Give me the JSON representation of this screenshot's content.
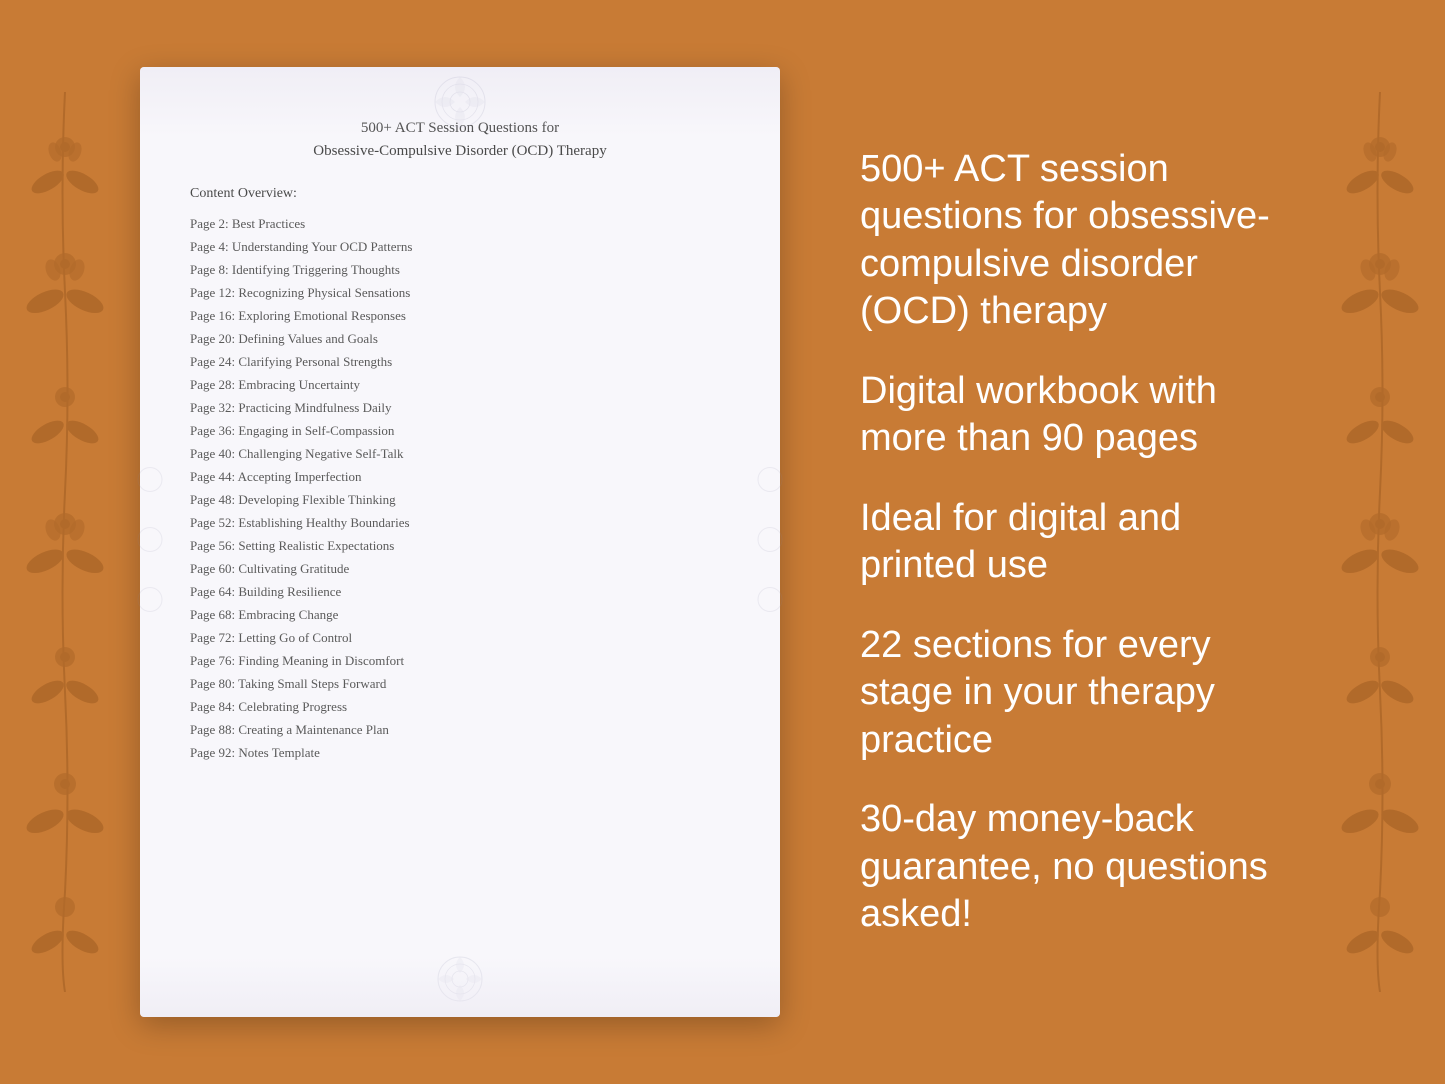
{
  "background": {
    "color": "#C87B35"
  },
  "document": {
    "title_line1": "500+ ACT Session Questions for",
    "title_line2": "Obsessive-Compulsive Disorder (OCD) Therapy",
    "content_overview_label": "Content Overview:",
    "toc_entries": [
      {
        "page": "Page  2:",
        "title": "Best Practices"
      },
      {
        "page": "Page  4:",
        "title": "Understanding Your OCD Patterns"
      },
      {
        "page": "Page  8:",
        "title": "Identifying Triggering Thoughts"
      },
      {
        "page": "Page 12:",
        "title": "Recognizing Physical Sensations"
      },
      {
        "page": "Page 16:",
        "title": "Exploring Emotional Responses"
      },
      {
        "page": "Page 20:",
        "title": "Defining Values and Goals"
      },
      {
        "page": "Page 24:",
        "title": "Clarifying Personal Strengths"
      },
      {
        "page": "Page 28:",
        "title": "Embracing Uncertainty"
      },
      {
        "page": "Page 32:",
        "title": "Practicing Mindfulness Daily"
      },
      {
        "page": "Page 36:",
        "title": "Engaging in Self-Compassion"
      },
      {
        "page": "Page 40:",
        "title": "Challenging Negative Self-Talk"
      },
      {
        "page": "Page 44:",
        "title": "Accepting Imperfection"
      },
      {
        "page": "Page 48:",
        "title": "Developing Flexible Thinking"
      },
      {
        "page": "Page 52:",
        "title": "Establishing Healthy Boundaries"
      },
      {
        "page": "Page 56:",
        "title": "Setting Realistic Expectations"
      },
      {
        "page": "Page 60:",
        "title": "Cultivating Gratitude"
      },
      {
        "page": "Page 64:",
        "title": "Building Resilience"
      },
      {
        "page": "Page 68:",
        "title": "Embracing Change"
      },
      {
        "page": "Page 72:",
        "title": "Letting Go of Control"
      },
      {
        "page": "Page 76:",
        "title": "Finding Meaning in Discomfort"
      },
      {
        "page": "Page 80:",
        "title": "Taking Small Steps Forward"
      },
      {
        "page": "Page 84:",
        "title": "Celebrating Progress"
      },
      {
        "page": "Page 88:",
        "title": "Creating a Maintenance Plan"
      },
      {
        "page": "Page 92:",
        "title": "Notes Template"
      }
    ]
  },
  "info_panel": {
    "blocks": [
      {
        "id": "block1",
        "text": "500+ ACT session questions for obsessive-compulsive disorder (OCD) therapy"
      },
      {
        "id": "block2",
        "text": "Digital workbook with more than 90 pages"
      },
      {
        "id": "block3",
        "text": "Ideal for digital and printed use"
      },
      {
        "id": "block4",
        "text": "22 sections for every stage in your therapy practice"
      },
      {
        "id": "block5",
        "text": "30-day money-back guarantee, no questions asked!"
      }
    ]
  }
}
